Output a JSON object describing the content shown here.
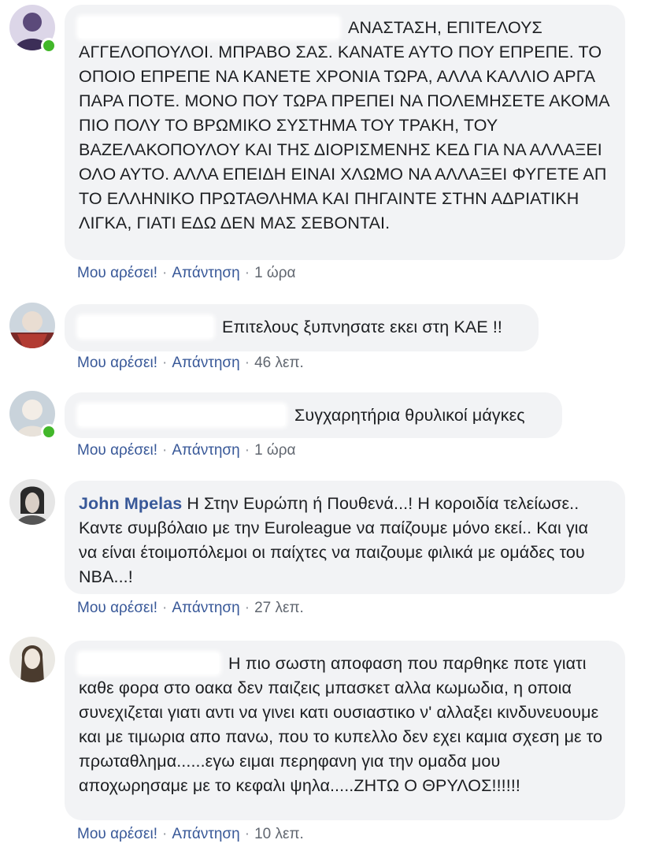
{
  "comments": [
    {
      "author": "",
      "text": "ΑΝΑΣΤΑΣΗ, ΕΠΙΤΕΛΟΥΣ ΑΓΓΕΛΟΠΟΥΛΟΙ. ΜΠΡΑΒΟ ΣΑΣ. ΚΑΝΑΤΕ ΑΥΤΟ ΠΟΥ ΕΠΡΕΠΕ. ΤΟ ΟΠΟΙΟ ΕΠΡΕΠΕ ΝΑ ΚΑΝΕΤΕ ΧΡΟΝΙΑ ΤΩΡΑ, ΑΛΛΑ ΚΑΛΛΙΟ ΑΡΓΑ ΠΑΡΑ ΠΟΤΕ. ΜΟΝΟ ΠΟΥ ΤΩΡΑ ΠΡΕΠΕΙ ΝΑ ΠΟΛΕΜΗΣΕΤΕ ΑΚΟΜΑ ΠΙΟ ΠΟΛΥ ΤΟ ΒΡΩΜΙΚΟ ΣΥΣΤΗΜΑ ΤΟΥ ΤΡΑΚΗ, ΤΟΥ ΒΑΖΕΛΑΚΟΠΟΥΛΟΥ ΚΑΙ ΤΗΣ ΔΙΟΡΙΣΜΕΝΗΣ ΚΕΔ ΓΙΑ ΝΑ ΑΛΛΑΞΕΙ ΟΛΟ ΑΥΤΟ. ΑΛΛΑ ΕΠΕΙΔΗ ΕΙΝΑΙ ΧΛΩΜΟ ΝΑ ΑΛΛΑΞΕΙ ΦΥΓΕΤΕ ΑΠ ΤΟ ΕΛΛΗΝΙΚΟ ΠΡΩΤΑΘΛΗΜΑ ΚΑΙ ΠΗΓΑΙΝΤΕ ΣΤΗΝ ΑΔΡΙΑΤΙΚΗ ΛΙΓΚΑ, ΓΙΑΤΙ ΕΔΩ ΔΕΝ ΜΑΣ ΣΕΒΟΝΤΑΙ.",
      "like_label": "Μου αρέσει!",
      "reply_label": "Απάντηση",
      "separator": "·",
      "time": "1 ώρα",
      "online": true
    },
    {
      "author": "",
      "text": "Επιτελους ξυπνησατε εκει στη ΚΑΕ !!",
      "like_label": "Μου αρέσει!",
      "reply_label": "Απάντηση",
      "separator": "·",
      "time": "46 λεπ.",
      "online": false
    },
    {
      "author": "",
      "text": "Συγχαρητήρια θρυλικοί μάγκες",
      "like_label": "Μου αρέσει!",
      "reply_label": "Απάντηση",
      "separator": "·",
      "time": "1 ώρα",
      "online": true
    },
    {
      "author": "John Mpelas",
      "text": "Η Στην Ευρώπη ή Πουθενά...! Η κοροιδία τελείωσε.. Καντε συμβόλαιο με την Euroleague να παίζουμε μόνο εκεί.. Και για να είναι έτοιμοπόλεμοι οι παίχτες να παιζουμε φιλικά με ομάδες του NBA...!",
      "like_label": "Μου αρέσει!",
      "reply_label": "Απάντηση",
      "separator": "·",
      "time": "27 λεπ.",
      "online": false
    },
    {
      "author": "",
      "text": "Η πιο σωστη αποφαση που παρθηκε ποτε γιατι καθε φορα στο οακα δεν παιζεις μπασκετ αλλα κωμωδια, η οποια συνεχιζεται γιατι αντι να γινει κατι ουσιαστικο ν' αλλαξει κινδυνευουμε και με τιμωρια απο πανω, που το κυπελλο δεν εχει καμια σχεση με το πρωταθλημα......εγω ειμαι περηφανη για την ομαδα μου αποχωρησαμε με το κεφαλι ψηλα.....ΖΗΤΩ Ο ΘΡΥΛΟΣ!!!!!!",
      "like_label": "Μου αρέσει!",
      "reply_label": "Απάντηση",
      "separator": "·",
      "time": "10 λεπ.",
      "online": false
    }
  ]
}
